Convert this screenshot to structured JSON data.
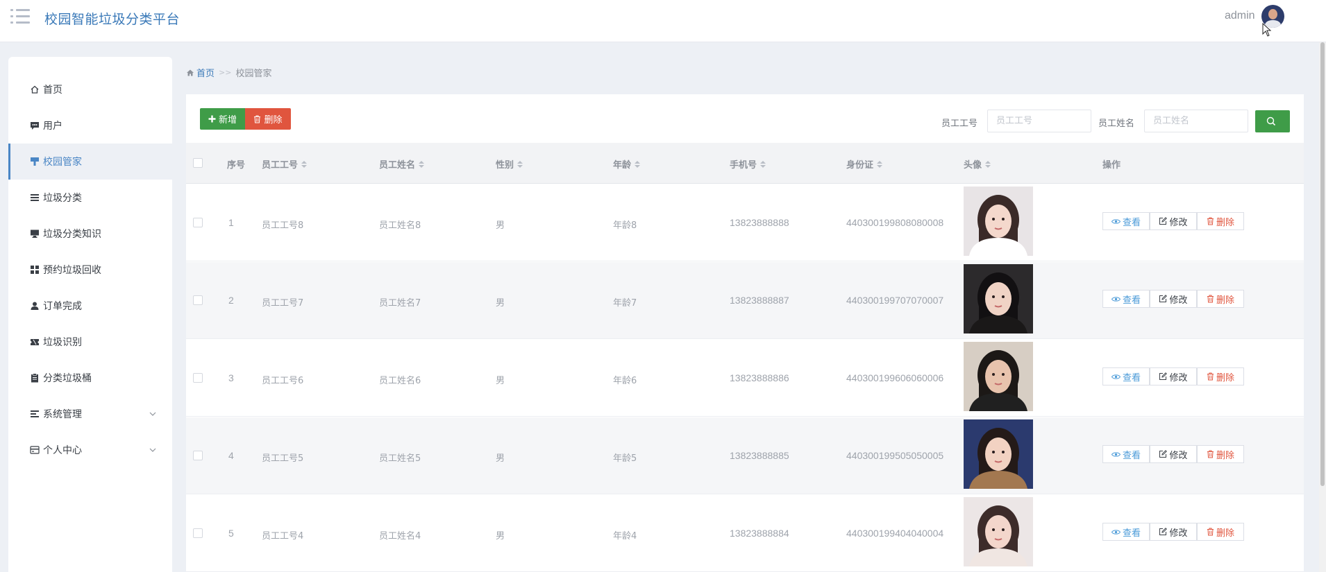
{
  "header": {
    "title": "校园智能垃圾分类平台",
    "user": "admin"
  },
  "sidebar": {
    "items": [
      {
        "label": "首页",
        "icon": "home-icon"
      },
      {
        "label": "用户",
        "icon": "chat-icon"
      },
      {
        "label": "校园管家",
        "icon": "brush-icon",
        "active": true
      },
      {
        "label": "垃圾分类",
        "icon": "list-icon"
      },
      {
        "label": "垃圾分类知识",
        "icon": "monitor-icon"
      },
      {
        "label": "预约垃圾回收",
        "icon": "grid-icon"
      },
      {
        "label": "订单完成",
        "icon": "user-icon"
      },
      {
        "label": "垃圾识别",
        "icon": "ticket-icon"
      },
      {
        "label": "分类垃圾桶",
        "icon": "clipboard-icon"
      },
      {
        "label": "系统管理",
        "icon": "settings-list-icon",
        "expandable": true
      },
      {
        "label": "个人中心",
        "icon": "card-icon",
        "expandable": true
      }
    ]
  },
  "breadcrumb": {
    "home": "首页",
    "separator": ">>",
    "current": "校园管家"
  },
  "toolbar": {
    "add_label": "新增",
    "delete_label": "删除",
    "employee_no_label": "员工工号",
    "employee_no_placeholder": "员工工号",
    "employee_name_label": "员工姓名",
    "employee_name_placeholder": "员工姓名"
  },
  "table": {
    "columns": {
      "index": "序号",
      "employee_no": "员工工号",
      "employee_name": "员工姓名",
      "gender": "性别",
      "age": "年龄",
      "phone": "手机号",
      "id_card": "身份证",
      "avatar": "头像",
      "actions": "操作"
    },
    "rows": [
      {
        "index": "1",
        "employee_no": "员工工号8",
        "employee_name": "员工姓名8",
        "gender": "男",
        "age": "年龄8",
        "phone": "13823888888",
        "id_card": "440300199808080008"
      },
      {
        "index": "2",
        "employee_no": "员工工号7",
        "employee_name": "员工姓名7",
        "gender": "男",
        "age": "年龄7",
        "phone": "13823888887",
        "id_card": "440300199707070007"
      },
      {
        "index": "3",
        "employee_no": "员工工号6",
        "employee_name": "员工姓名6",
        "gender": "男",
        "age": "年龄6",
        "phone": "13823888886",
        "id_card": "440300199606060006"
      },
      {
        "index": "4",
        "employee_no": "员工工号5",
        "employee_name": "员工姓名5",
        "gender": "男",
        "age": "年龄5",
        "phone": "13823888885",
        "id_card": "440300199505050005"
      },
      {
        "index": "5",
        "employee_no": "员工工号4",
        "employee_name": "员工姓名4",
        "gender": "男",
        "age": "年龄4",
        "phone": "13823888884",
        "id_card": "440300199404040004"
      }
    ],
    "actions": {
      "view": "查看",
      "edit": "修改",
      "delete": "删除"
    }
  },
  "colors": {
    "brand_blue": "#3a79b8",
    "green": "#3f9c48",
    "red": "#e0553e",
    "link_blue": "#4a9ad8"
  }
}
